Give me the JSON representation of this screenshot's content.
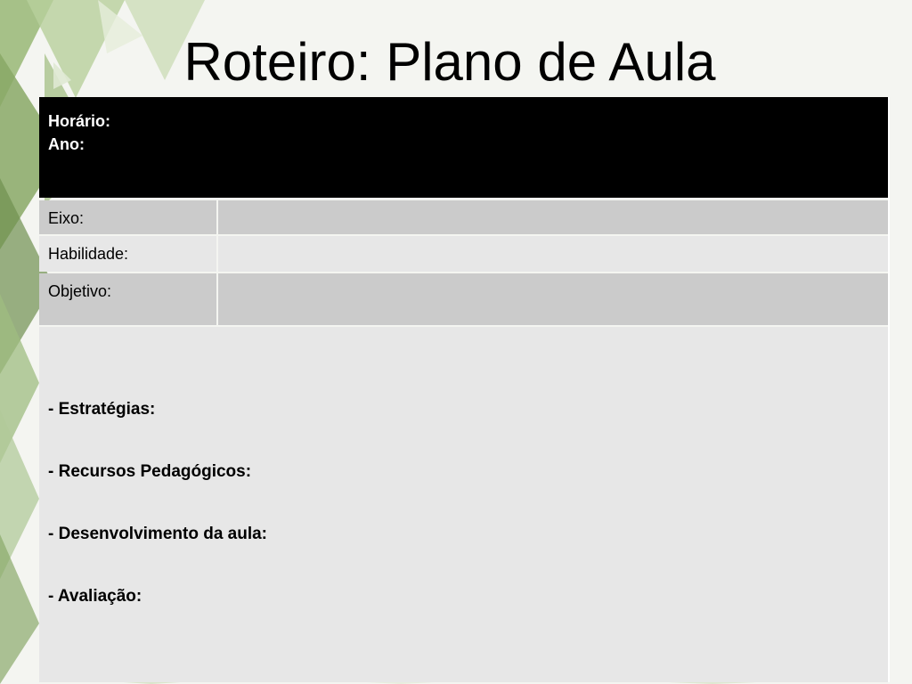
{
  "slide": {
    "title": "Roteiro: Plano de Aula"
  },
  "header": {
    "line1": "Horário:",
    "line2": "Ano:"
  },
  "rows": [
    {
      "label": "Eixo:",
      "value": ""
    },
    {
      "label": "Habilidade:",
      "value": ""
    },
    {
      "label": "Objetivo:",
      "value": ""
    }
  ],
  "sections": [
    "- Estratégias:",
    "- Recursos Pedagógicos:",
    "- Desenvolvimento da aula:",
    "- Avaliação:"
  ],
  "colors": {
    "header_bg": "#000000",
    "row_dark": "#cbcbcb",
    "row_light": "#e7e7e7",
    "decor_green": "#8fb070"
  }
}
